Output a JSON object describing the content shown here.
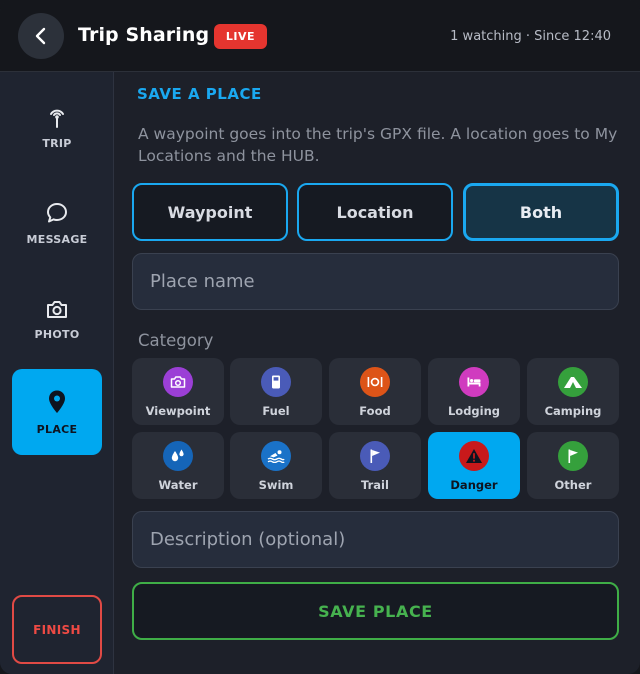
{
  "header": {
    "title": "Trip Sharing",
    "live_badge": "LIVE",
    "status": "1 watching · Since 12:40"
  },
  "sidebar": {
    "items": [
      {
        "label": "TRIP",
        "icon": "antenna-icon",
        "active": false
      },
      {
        "label": "MESSAGE",
        "icon": "chat-bubble-icon",
        "active": false
      },
      {
        "label": "PHOTO",
        "icon": "camera-icon",
        "active": false
      },
      {
        "label": "PLACE",
        "icon": "location-pin-icon",
        "active": true
      }
    ],
    "finish_label": "FINISH"
  },
  "main": {
    "section_title": "SAVE A PLACE",
    "description": "A waypoint goes into the trip's GPX file. A location goes to My Locations and the HUB.",
    "save_type": {
      "options": [
        "Waypoint",
        "Location",
        "Both"
      ],
      "selected": "Both"
    },
    "place_name_placeholder": "Place name",
    "category_label": "Category",
    "categories": [
      {
        "name": "Viewpoint",
        "icon": "camera-icon",
        "color": "#9b3fd6"
      },
      {
        "name": "Fuel",
        "icon": "fuel-pump-icon",
        "color": "#4a5bb8"
      },
      {
        "name": "Food",
        "icon": "plate-cutlery-icon",
        "color": "#dd5418"
      },
      {
        "name": "Lodging",
        "icon": "bed-icon",
        "color": "#d03bbf"
      },
      {
        "name": "Camping",
        "icon": "tent-icon",
        "color": "#35a03c"
      },
      {
        "name": "Water",
        "icon": "water-drops-icon",
        "color": "#1565b8"
      },
      {
        "name": "Swim",
        "icon": "swimmer-icon",
        "color": "#1a72c8"
      },
      {
        "name": "Trail",
        "icon": "flag-icon",
        "color": "#4a5bb8"
      },
      {
        "name": "Danger",
        "icon": "warning-icon",
        "color": "#c8191b",
        "active": true
      },
      {
        "name": "Other",
        "icon": "flag-icon",
        "color": "#35a03c"
      }
    ],
    "description_placeholder": "Description (optional)",
    "save_label": "SAVE PLACE"
  },
  "colors": {
    "accent": "#00a8f0",
    "live": "#e5352f",
    "finish": "#e04a45",
    "save": "#3fae47"
  }
}
